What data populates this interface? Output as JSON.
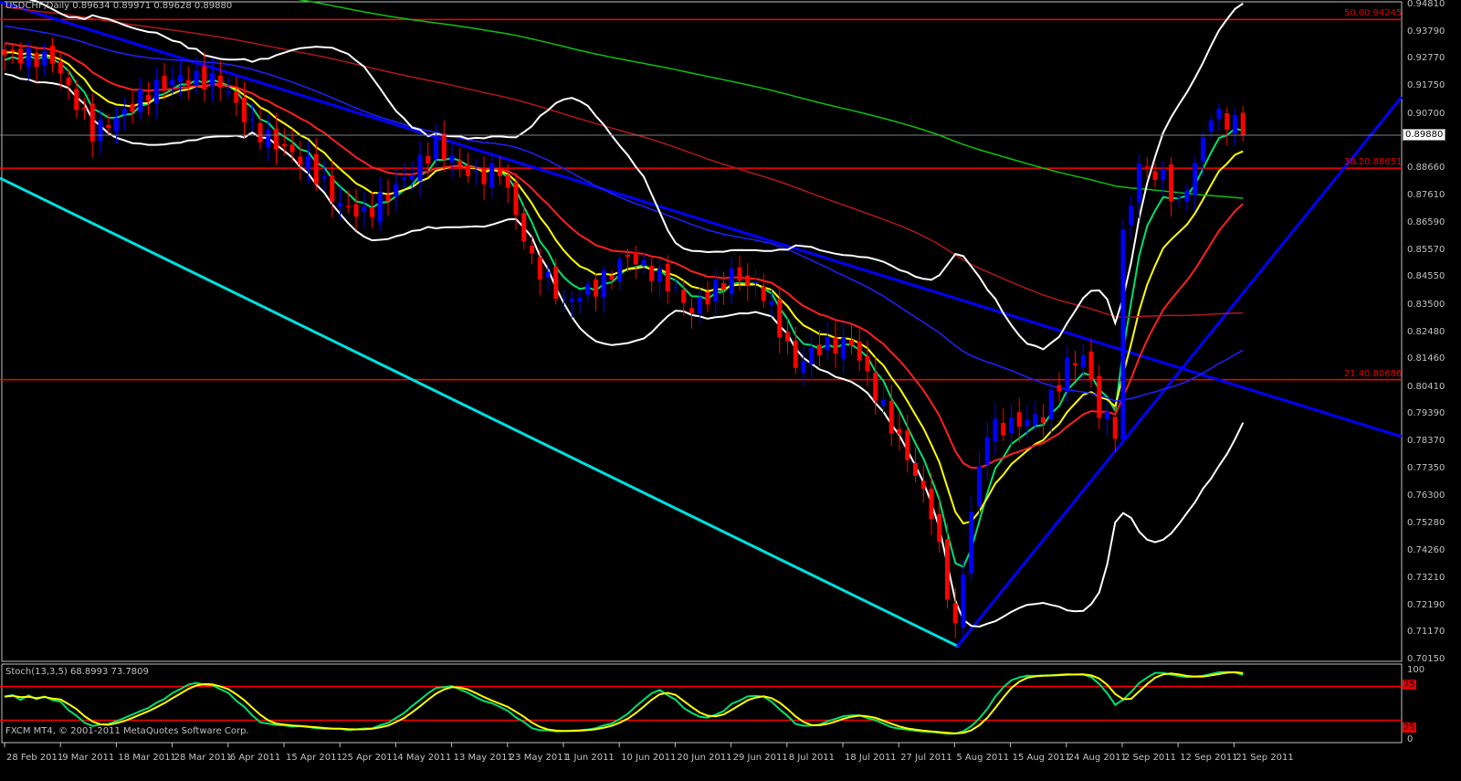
{
  "header": {
    "symbol": "USDCHF,Daily",
    "ohlc": "0.89634 0.89971 0.89628 0.89880"
  },
  "stoch": {
    "label": "Stoch(13,3,5) 68.8993 73.7809",
    "levels": [
      "100",
      "75",
      "25",
      "0"
    ]
  },
  "copyright": "FXCM MT4, © 2001-2011 MetaQuotes Software Corp.",
  "current_price": "0.89880",
  "price_axis": [
    "0.94810",
    "0.93790",
    "0.92770",
    "0.91750",
    "0.90700",
    "0.88660",
    "0.87610",
    "0.86590",
    "0.85570",
    "0.84550",
    "0.83500",
    "0.82480",
    "0.81460",
    "0.80410",
    "0.79390",
    "0.78370",
    "0.77350",
    "0.76300",
    "0.75280",
    "0.74260",
    "0.73210",
    "0.72190",
    "0.71170",
    "0.70150"
  ],
  "fibo": [
    {
      "level": "50.0",
      "price": "0.94245"
    },
    {
      "level": "38.2",
      "price": "0.88651"
    },
    {
      "level": "21.4",
      "price": "0.80686"
    }
  ],
  "dates": [
    "28 Feb 2011",
    "9 Mar 2011",
    "18 Mar 2011",
    "28 Mar 2011",
    "6 Apr 2011",
    "15 Apr 2011",
    "25 Apr 2011",
    "4 May 2011",
    "13 May 2011",
    "23 May 2011",
    "1 Jun 2011",
    "10 Jun 2011",
    "20 Jun 2011",
    "29 Jun 2011",
    "8 Jul 2011",
    "18 Jul 2011",
    "27 Jul 2011",
    "5 Aug 2011",
    "15 Aug 2011",
    "24 Aug 2011",
    "2 Sep 2011",
    "12 Sep 2011",
    "21 Sep 2011"
  ],
  "chart_data": {
    "type": "candlestick",
    "title": "USDCHF,Daily",
    "ylim": [
      0.7015,
      0.9481
    ],
    "bars": 156,
    "close_keypoints": [
      [
        0,
        0.9292
      ],
      [
        6,
        0.9275
      ],
      [
        11,
        0.9
      ],
      [
        14,
        0.9051
      ],
      [
        18,
        0.9154
      ],
      [
        22,
        0.9206
      ],
      [
        27,
        0.9189
      ],
      [
        31,
        0.9017
      ],
      [
        38,
        0.8879
      ],
      [
        42,
        0.8724
      ],
      [
        45,
        0.869
      ],
      [
        49,
        0.8793
      ],
      [
        54,
        0.8948
      ],
      [
        59,
        0.8827
      ],
      [
        62,
        0.8862
      ],
      [
        66,
        0.8518
      ],
      [
        70,
        0.8363
      ],
      [
        74,
        0.8415
      ],
      [
        78,
        0.8535
      ],
      [
        83,
        0.8432
      ],
      [
        86,
        0.8329
      ],
      [
        91,
        0.8466
      ],
      [
        95,
        0.8397
      ],
      [
        99,
        0.8122
      ],
      [
        102,
        0.8191
      ],
      [
        106,
        0.8208
      ],
      [
        109,
        0.8019
      ],
      [
        113,
        0.7778
      ],
      [
        116,
        0.7572
      ],
      [
        119,
        0.7125
      ],
      [
        121,
        0.7572
      ],
      [
        123,
        0.7881
      ],
      [
        126,
        0.7899
      ],
      [
        130,
        0.7933
      ],
      [
        133,
        0.8122
      ],
      [
        135,
        0.8157
      ],
      [
        137,
        0.795
      ],
      [
        139,
        0.7881
      ],
      [
        140,
        0.8604
      ],
      [
        142,
        0.8879
      ],
      [
        145,
        0.8827
      ],
      [
        147,
        0.8724
      ],
      [
        149,
        0.8879
      ],
      [
        151,
        0.9068
      ],
      [
        154,
        0.9034
      ],
      [
        155,
        0.8988
      ]
    ],
    "moving_averages": [
      {
        "period": 5,
        "color": "#00e070"
      },
      {
        "period": 10,
        "color": "#ffff00"
      },
      {
        "period": 20,
        "color": "#ff2020"
      },
      {
        "period": 50,
        "color": "#2020ff"
      },
      {
        "period": 100,
        "color": "#b01818"
      },
      {
        "period": 200,
        "color": "#10c010"
      }
    ],
    "bollinger": {
      "period": 20,
      "deviation": 2,
      "color": "#ffffff"
    },
    "stochastic": {
      "k": 13,
      "d": 3,
      "slowing": 5,
      "k_color": "#00e070",
      "d_color": "#ffff00",
      "levels": [
        75,
        25
      ]
    },
    "bull_color": "#0000ff",
    "bear_color": "#ff0000"
  }
}
